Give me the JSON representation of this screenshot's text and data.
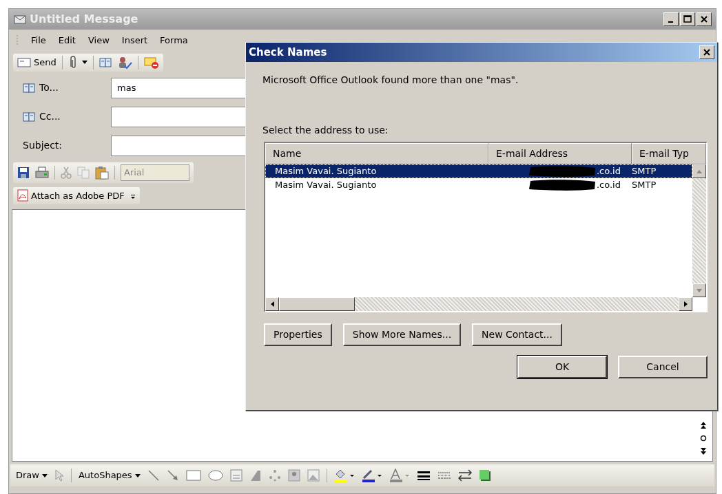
{
  "window": {
    "title": "Untitled Message"
  },
  "menu": [
    "File",
    "Edit",
    "View",
    "Insert",
    "Forma"
  ],
  "standard_toolbar": {
    "send": "Send"
  },
  "fields": [
    {
      "kind": "book",
      "label": "To...",
      "value": "mas"
    },
    {
      "kind": "book",
      "label": "Cc..."
    },
    {
      "kind": "plain",
      "label": "Subject:"
    }
  ],
  "format_toolbar": {
    "font": "Arial"
  },
  "pdf_toolbar": {
    "label": "Attach as Adobe PDF"
  },
  "drawing_toolbar": {
    "draw": "Draw",
    "autoshapes": "AutoShapes"
  },
  "dialog": {
    "title": "Check Names",
    "message": "Microsoft Office Outlook found more than one \"mas\".",
    "prompt": "Select the address to use:",
    "columns": [
      "Name",
      "E-mail Address",
      "E-mail Typ"
    ],
    "rows": [
      {
        "name": "Masim Vavai. Sugianto",
        "address": ".co.id",
        "type": "SMTP",
        "selected": true
      },
      {
        "name": "Masim Vavai. Sugianto",
        "address": ".co.id",
        "type": "SMTP",
        "selected": false
      }
    ],
    "actions": [
      "Properties",
      "Show More Names...",
      "New Contact..."
    ],
    "buttons": [
      {
        "label": "OK",
        "default": true
      },
      {
        "label": "Cancel",
        "default": false
      }
    ]
  }
}
